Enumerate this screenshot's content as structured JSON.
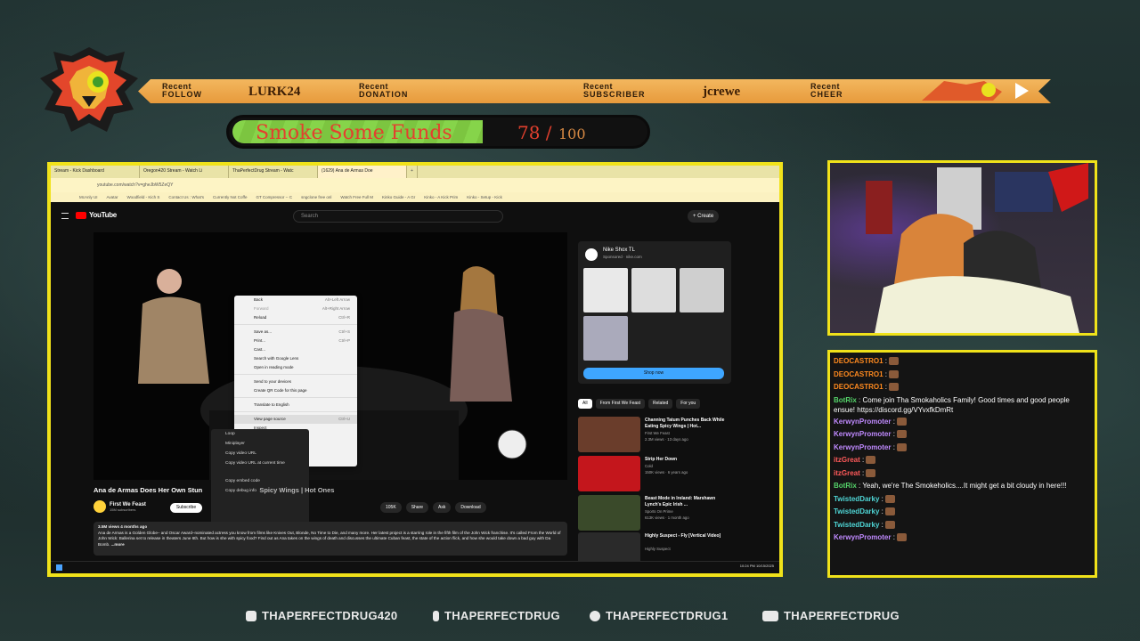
{
  "ticker": {
    "follow": {
      "l1": "Recent",
      "l2": "FOLLOW",
      "name": "LURK24"
    },
    "donation": {
      "l1": "Recent",
      "l2": "DONATION",
      "name": ""
    },
    "subscriber": {
      "l1": "Recent",
      "l2": "SUBSCRIBER",
      "name": "jcrewe"
    },
    "cheer": {
      "l1": "Recent",
      "l2": "CHEER",
      "name": ""
    }
  },
  "goal": {
    "title": "Smoke Some Funds",
    "current": "78 /",
    "max": "100",
    "progress_percent": 78
  },
  "browser": {
    "tabs": [
      "Stream - Kick Dashboard",
      "Oregon420 Stream - Watch Li",
      "ThaPerfectDrug Stream - Watc",
      "(1629) Ana de Armas Doe"
    ],
    "plus": "+",
    "url": "youtube.com/watch?v=gheJbW5ZeQY",
    "bookmarks": [
      "McAnly UI",
      "Avatar",
      "Woodfield - Kich S",
      "Contact Us : What's",
      "Currently Not Coffe",
      "GT Compressor -- C",
      "sngclone free onl",
      "Watch Free Full M",
      "Kinko Guide - A Gr",
      "Kinko - A Kick Prim",
      "Kinko - Setup - Kick"
    ]
  },
  "youtube": {
    "brand": "YouTube",
    "search_placeholder": "Search",
    "create_label": "+ Create",
    "video_title": "Ana de Armas Does Her Own Stun",
    "video_title_overlay": "Spicy Wings | Hot Ones",
    "channel_name": "First We Feast",
    "subscribers": "15M subscribers",
    "subscribe_label": "Subscribe",
    "actions": [
      "105K",
      "Share",
      "Ask",
      "Download"
    ],
    "description_meta": "3.5M views  4 months ago",
    "description": "Ana de Armas is a Golden Globe– and Oscar Award–nominated actress you know from films like Knives Out, Blonde, No Time to Die, and many more. Her latest project is a starring role in the fifth film of the John Wick franchise. It's called From the World of John Wick: Ballerina set to release in theaters June 6th. But how is she with spicy food? Find out as Ana takes on the wings of death and discusses the ultimate Cuban feast, the state of the action flick, and how she would take down a bad guy with Da Bomb.",
    "more_label": "...more",
    "ad": {
      "title": "Nike Shox TL",
      "sponsor": "Sponsored · nike.com",
      "shop_label": "Shop now"
    },
    "chips": [
      "All",
      "From First We Feast",
      "Related",
      "For you"
    ],
    "recommendations": [
      {
        "title": "Channing Tatum Punches Back While Eating Spicy Wings | Hot...",
        "channel": "First We Feast",
        "meta": "2.3M views · 13 days ago",
        "duration": "24:14"
      },
      {
        "title": "Strip Her Down",
        "channel": "Cold",
        "meta": "150K views · 6 years ago",
        "duration": "6:14"
      },
      {
        "title": "Beast Mode in Ireland: Marshawn Lynch's Epic Irish ...",
        "channel": "Sports On Prime",
        "meta": "613K views · 1 month ago",
        "duration": "22:14"
      },
      {
        "title": "Highly Suspect - Fly [Vertical Video]",
        "channel": "Highly Suspect",
        "meta": "",
        "duration": ""
      }
    ],
    "context_menu": [
      {
        "label": "Back",
        "shortcut": "Alt+Left Arrow"
      },
      {
        "label": "Forward",
        "shortcut": "Alt+Right Arrow"
      },
      {
        "label": "Reload",
        "shortcut": "Ctrl+R"
      },
      {
        "label": "Save as...",
        "shortcut": "Ctrl+S"
      },
      {
        "label": "Print...",
        "shortcut": "Ctrl+P"
      },
      {
        "label": "Cast...",
        "shortcut": ""
      },
      {
        "label": "Search with Google Lens",
        "shortcut": ""
      },
      {
        "label": "Open in reading mode",
        "shortcut": ""
      },
      {
        "label": "Send to your devices",
        "shortcut": ""
      },
      {
        "label": "Create QR Code for this page",
        "shortcut": ""
      },
      {
        "label": "Translate to English",
        "shortcut": ""
      },
      {
        "label": "View page source",
        "shortcut": "Ctrl+U"
      },
      {
        "label": "Inspect",
        "shortcut": ""
      }
    ],
    "player_menu": [
      "Loop",
      "Miniplayer",
      "Copy video URL",
      "Copy video URL at current time",
      "Copy embed code",
      "Copy debug info"
    ],
    "clock": "10:24 PM 10/15/2025"
  },
  "chat": [
    {
      "user": "DEOCASTRO1",
      "msg": "",
      "color": "#ff8a1f"
    },
    {
      "user": "DEOCASTRO1",
      "msg": "",
      "color": "#ff8a1f"
    },
    {
      "user": "DEOCASTRO1",
      "msg": "",
      "color": "#ff8a1f"
    },
    {
      "user": "BotRix",
      "msg": "Come join Tha Smokaholics Family! Good times and good people ensue! https://discord.gg/VYvxfkDmRt",
      "color": "#55d46a"
    },
    {
      "user": "KerwynPromoter",
      "msg": "",
      "color": "#c08aff"
    },
    {
      "user": "KerwynPromoter",
      "msg": "",
      "color": "#c08aff"
    },
    {
      "user": "KerwynPromoter",
      "msg": "",
      "color": "#c08aff"
    },
    {
      "user": "itzGreat",
      "msg": "",
      "color": "#ff5a5a"
    },
    {
      "user": "itzGreat",
      "msg": "",
      "color": "#ff5a5a"
    },
    {
      "user": "BotRix",
      "msg": "Yeah, we're The Smokeholics....It might get a bit cloudy in here!!!",
      "color": "#55d46a"
    },
    {
      "user": "TwistedDarky",
      "msg": "",
      "color": "#4fd6d6"
    },
    {
      "user": "TwistedDarky",
      "msg": "",
      "color": "#4fd6d6"
    },
    {
      "user": "TwistedDarky",
      "msg": "",
      "color": "#4fd6d6"
    },
    {
      "user": "KerwynPromoter",
      "msg": "",
      "color": "#c08aff"
    }
  ],
  "socials": [
    "THAPERFECTDRUG420",
    "THAPERFECTDRUG",
    "THAPERFECTDRUG1",
    "THAPERFECTDRUG"
  ],
  "social_icons": [
    "instagram-icon",
    "facebook-icon",
    "twitter-icon",
    "youtube-icon"
  ]
}
